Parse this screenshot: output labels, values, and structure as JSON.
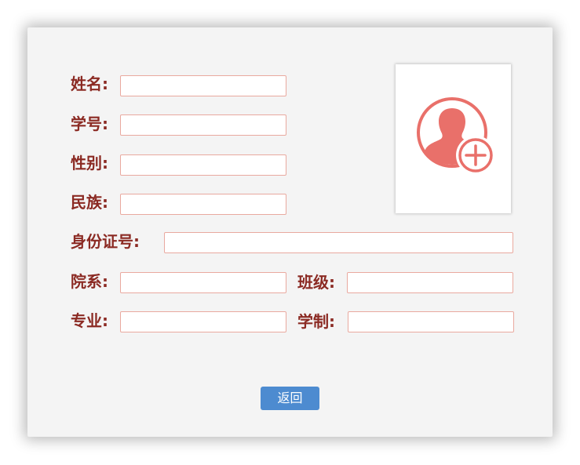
{
  "form": {
    "name_label": "姓名:",
    "student_id_label": "学号:",
    "gender_label": "性别:",
    "ethnicity_label": "民族:",
    "id_number_label": "身份证号:",
    "department_label": "院系:",
    "class_label": "班级:",
    "major_label": "专业:",
    "duration_label": "学制:",
    "name_value": "",
    "student_id_value": "",
    "gender_value": "",
    "ethnicity_value": "",
    "id_number_value": "",
    "department_value": "",
    "class_value": "",
    "major_value": "",
    "duration_value": ""
  },
  "photo": {
    "icon": "avatar-add-icon",
    "icon_color": "#e9706a"
  },
  "actions": {
    "back_label": "返回"
  },
  "colors": {
    "label": "#8b2a23",
    "field_border": "#e9a99f",
    "button": "#4d8bd0",
    "panel": "#f4f4f4"
  }
}
